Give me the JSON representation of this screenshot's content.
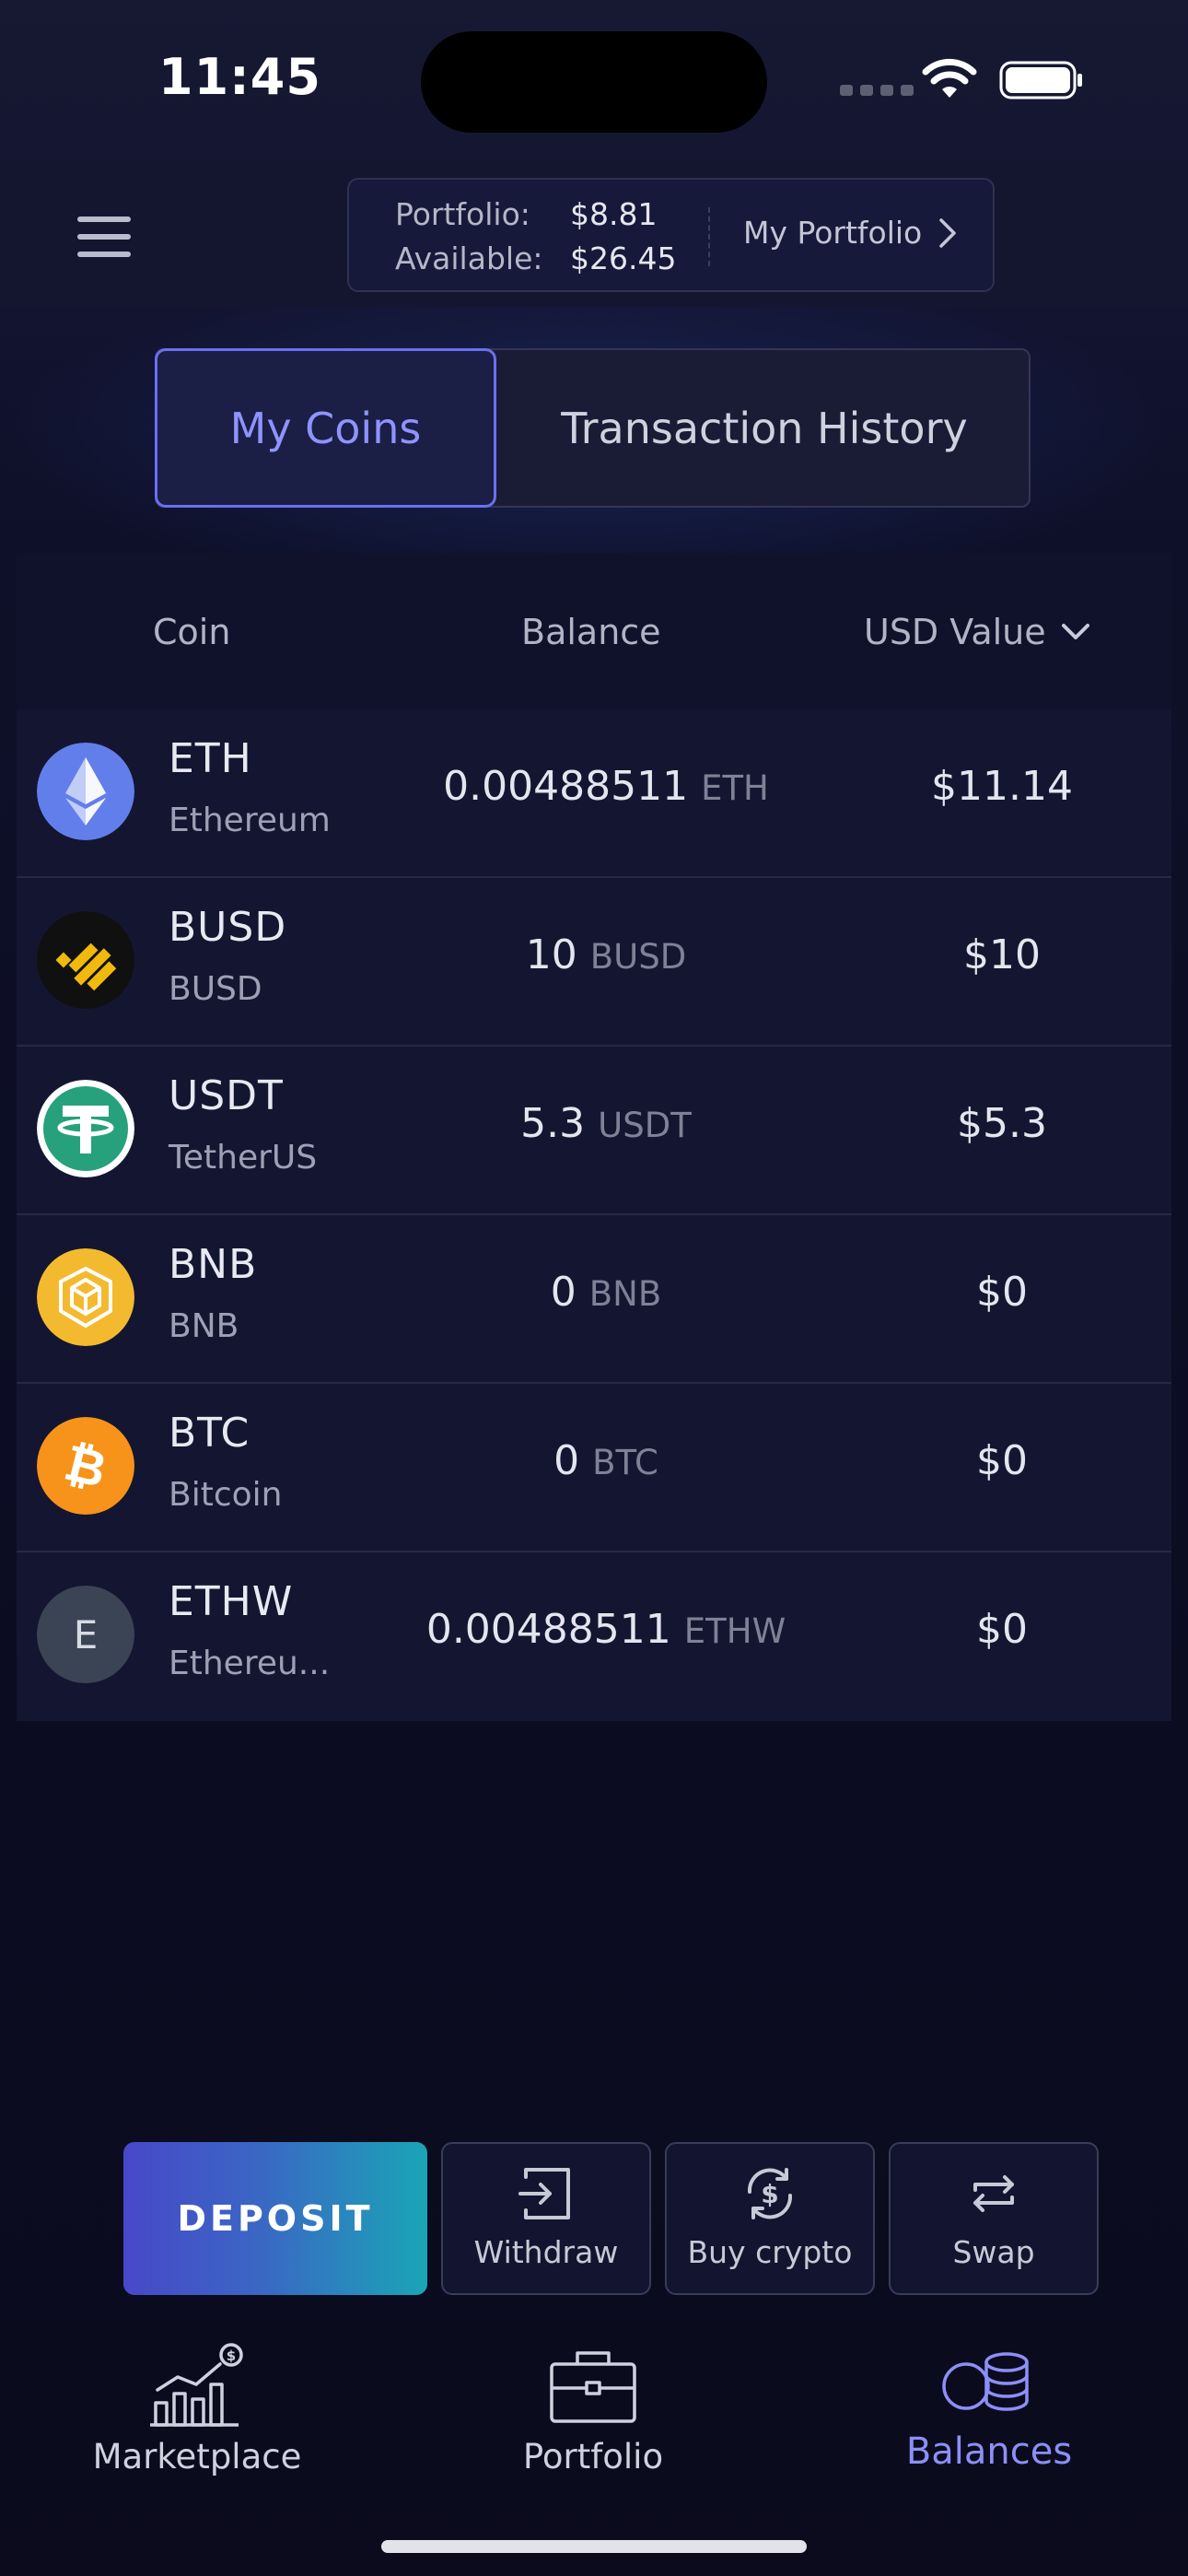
{
  "status_bar": {
    "time": "11:45"
  },
  "header": {
    "portfolio_label": "Portfolio:",
    "portfolio_value": "$8.81",
    "available_label": "Available:",
    "available_value": "$26.45",
    "my_portfolio_link": "My Portfolio"
  },
  "tabs": [
    {
      "label": "My Coins",
      "active": true
    },
    {
      "label": "Transaction History",
      "active": false
    }
  ],
  "table": {
    "columns": {
      "coin": "Coin",
      "balance": "Balance",
      "usd_value": "USD Value"
    },
    "rows": [
      {
        "symbol": "ETH",
        "name": "Ethereum",
        "balance": "0.00488511",
        "unit": "ETH",
        "usd": "$11.14",
        "icon": "ethereum-logo-icon",
        "color": "#627eea"
      },
      {
        "symbol": "BUSD",
        "name": "BUSD",
        "balance": "10",
        "unit": "BUSD",
        "usd": "$10",
        "icon": "busd-logo-icon",
        "color": "#f0b90b"
      },
      {
        "symbol": "USDT",
        "name": "TetherUS",
        "balance": "5.3",
        "unit": "USDT",
        "usd": "$5.3",
        "icon": "tether-logo-icon",
        "color": "#26a17b"
      },
      {
        "symbol": "BNB",
        "name": "BNB",
        "balance": "0",
        "unit": "BNB",
        "usd": "$0",
        "icon": "bnb-logo-icon",
        "color": "#f3ba2f"
      },
      {
        "symbol": "BTC",
        "name": "Bitcoin",
        "balance": "0",
        "unit": "BTC",
        "usd": "$0",
        "icon": "bitcoin-logo-icon",
        "color": "#f7931a"
      },
      {
        "symbol": "ETHW",
        "name": "Ethereu...",
        "balance": "0.00488511",
        "unit": "ETHW",
        "usd": "$0",
        "icon": "ethw-letter-icon",
        "letter": "E",
        "color": "#3b4454"
      }
    ]
  },
  "actions": {
    "deposit": "DEPOSIT",
    "withdraw": "Withdraw",
    "buy_crypto": "Buy crypto",
    "swap": "Swap"
  },
  "nav": {
    "marketplace": "Marketplace",
    "portfolio": "Portfolio",
    "balances": "Balances",
    "active": "balances"
  },
  "colors": {
    "accent": "#8c8ff7",
    "background": "#0b0c1f"
  }
}
